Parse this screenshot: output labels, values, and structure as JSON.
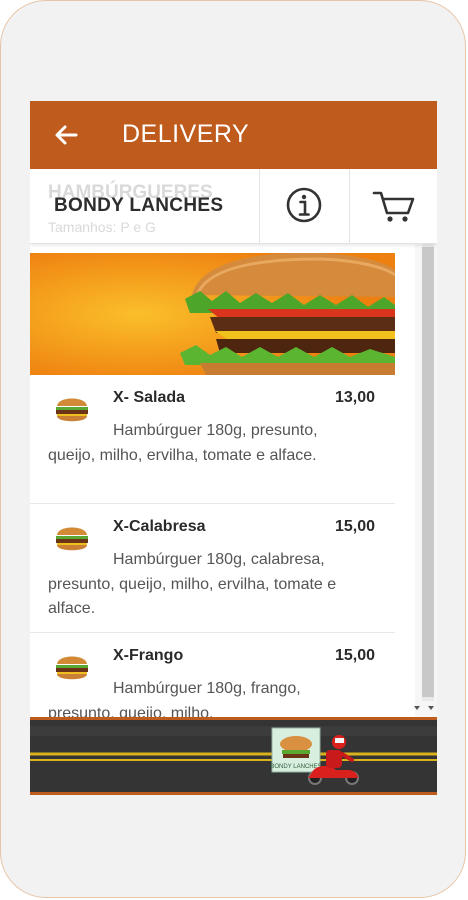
{
  "appbar": {
    "title": "DELIVERY",
    "back_icon": "arrow-left-icon",
    "color": "#c05b1e"
  },
  "toolbar": {
    "ghost_category": "HAMBÚRGUERES",
    "ghost_sizes": "Tamanhos: P e G",
    "store_name": "BONDY LANCHES",
    "info_icon": "info-icon",
    "cart_icon": "cart-icon"
  },
  "menu": {
    "items": [
      {
        "name": "X- Salada",
        "price": "13,00",
        "description": "Hambúrguer 180g, presunto, queijo, milho, ervilha, tomate e alface.",
        "icon": "burger-icon"
      },
      {
        "name": "X-Calabresa",
        "price": "15,00",
        "description": "Hambúrguer 180g, calabresa, presunto, queijo, milho, ervilha, tomate e alface.",
        "icon": "burger-icon"
      },
      {
        "name": "X-Frango",
        "price": "15,00",
        "description": "Hambúrguer 180g, frango, presunto, queijo, milho,",
        "icon": "burger-icon"
      }
    ]
  },
  "footer": {
    "logo_text": "BONDY LANCHES",
    "illustration": "delivery-scooter"
  }
}
